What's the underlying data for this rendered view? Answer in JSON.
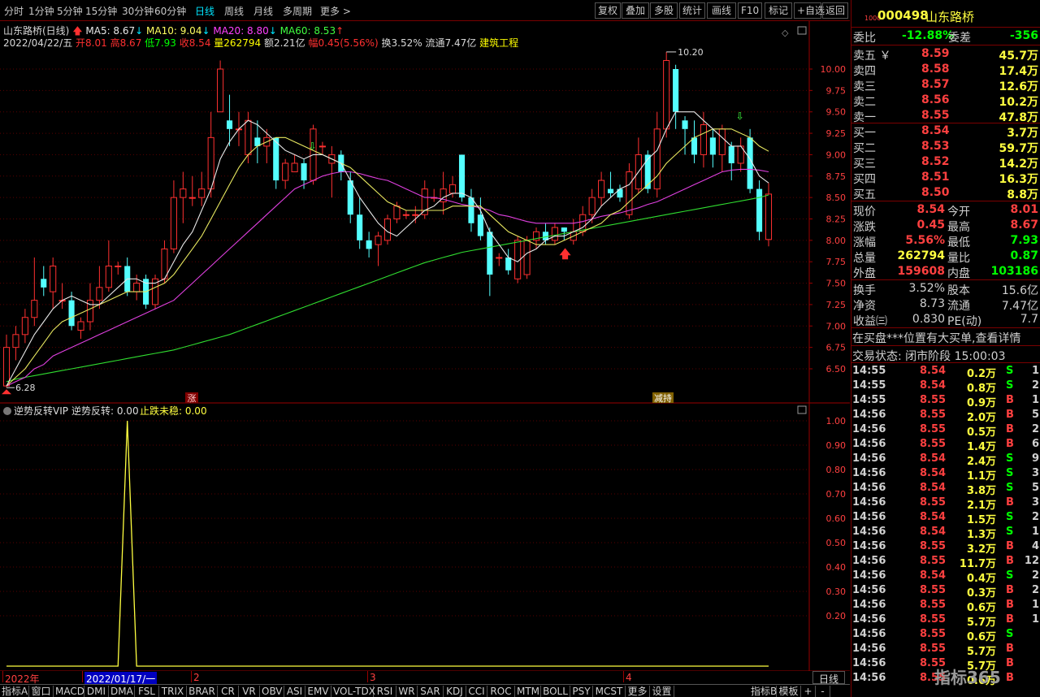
{
  "toolbar": {
    "periods": [
      "分时",
      "1分钟",
      "5分钟",
      "15分钟",
      "30分钟",
      "60分钟",
      "日线",
      "周线",
      "月线",
      "多周期",
      "更多 >"
    ],
    "active": "日线",
    "buttons": [
      "复权",
      "叠加",
      "多股",
      "统计",
      "画线",
      "F10",
      "标记",
      "+自选",
      "返回"
    ]
  },
  "info": {
    "name": "山东路桥(日线)",
    "ma5": "MA5: 8.67",
    "ma10": "MA10: 9.04",
    "ma20": "MA20: 8.80",
    "ma60": "MA60: 8.53",
    "date": "2022/04/22/五",
    "open": "开8.01",
    "high": "高8.67",
    "low": "低7.93",
    "close": "收8.54",
    "vol": "量262794",
    "amount": "额2.21亿",
    "amp": "幅0.45(5.56%)",
    "turnover": "换3.52%",
    "float": "流通7.47亿",
    "sector": "建筑工程"
  },
  "markers": {
    "high_label": "10.20",
    "low_label": "6.28",
    "zhang": "涨",
    "jianchi": "减持"
  },
  "indicator": {
    "name": "逆势反转VIP",
    "line1": "逆势反转: 0.00",
    "line2": "止跌未稳: 0.00",
    "ticks": [
      "1.00",
      "0.90",
      "0.80",
      "0.70",
      "0.60",
      "0.50",
      "0.40",
      "0.30",
      "0.20"
    ]
  },
  "chart_data": {
    "type": "candlestick",
    "price_ticks": [
      "10.00",
      "9.75",
      "9.50",
      "9.25",
      "9.00",
      "8.75",
      "8.50",
      "8.25",
      "8.00",
      "7.75",
      "7.50",
      "7.25",
      "7.00",
      "6.75",
      "6.50"
    ],
    "ylim": [
      6.28,
      10.2
    ],
    "date_labels": [
      "2022年",
      "2022/01/17/一",
      "2",
      "3",
      "4"
    ],
    "candles": [
      {
        "o": 6.3,
        "c": 6.75,
        "h": 6.9,
        "l": 6.28
      },
      {
        "o": 6.75,
        "c": 6.9,
        "h": 7.0,
        "l": 6.6
      },
      {
        "o": 6.9,
        "c": 7.1,
        "h": 7.2,
        "l": 6.8
      },
      {
        "o": 7.1,
        "c": 7.3,
        "h": 7.8,
        "l": 7.0
      },
      {
        "o": 7.55,
        "c": 7.45,
        "h": 7.7,
        "l": 7.35
      },
      {
        "o": 7.4,
        "c": 7.7,
        "h": 7.8,
        "l": 7.2
      },
      {
        "o": 7.3,
        "c": 7.3,
        "h": 7.5,
        "l": 7.2
      },
      {
        "o": 7.3,
        "c": 7.0,
        "h": 7.4,
        "l": 6.95
      },
      {
        "o": 6.95,
        "c": 7.05,
        "h": 7.1,
        "l": 6.85
      },
      {
        "o": 7.05,
        "c": 7.3,
        "h": 7.5,
        "l": 6.95
      },
      {
        "o": 7.3,
        "c": 7.45,
        "h": 7.7,
        "l": 7.2
      },
      {
        "o": 7.45,
        "c": 7.7,
        "h": 8.0,
        "l": 7.4
      },
      {
        "o": 7.7,
        "c": 7.7,
        "h": 7.75,
        "l": 7.6
      },
      {
        "o": 7.7,
        "c": 7.4,
        "h": 7.8,
        "l": 7.35
      },
      {
        "o": 7.4,
        "c": 7.5,
        "h": 7.6,
        "l": 7.3
      },
      {
        "o": 7.55,
        "c": 7.25,
        "h": 7.6,
        "l": 7.2
      },
      {
        "o": 7.25,
        "c": 7.55,
        "h": 7.6,
        "l": 7.2
      },
      {
        "o": 7.55,
        "c": 7.9,
        "h": 8.0,
        "l": 7.5
      },
      {
        "o": 7.9,
        "c": 8.5,
        "h": 8.7,
        "l": 7.85
      },
      {
        "o": 8.5,
        "c": 8.6,
        "h": 8.8,
        "l": 8.2
      },
      {
        "o": 8.5,
        "c": 8.5,
        "h": 8.75,
        "l": 8.4
      },
      {
        "o": 8.5,
        "c": 8.6,
        "h": 8.8,
        "l": 8.4
      },
      {
        "o": 8.6,
        "c": 9.2,
        "h": 9.5,
        "l": 8.5
      },
      {
        "o": 9.5,
        "c": 10.0,
        "h": 10.1,
        "l": 9.5
      },
      {
        "o": 9.4,
        "c": 9.3,
        "h": 9.7,
        "l": 9.1
      },
      {
        "o": 9.3,
        "c": 9.3,
        "h": 9.5,
        "l": 9.1
      },
      {
        "o": 9.0,
        "c": 9.4,
        "h": 9.5,
        "l": 8.9
      },
      {
        "o": 9.2,
        "c": 9.1,
        "h": 9.4,
        "l": 8.9
      },
      {
        "o": 9.1,
        "c": 9.2,
        "h": 9.3,
        "l": 8.9
      },
      {
        "o": 9.2,
        "c": 8.7,
        "h": 9.2,
        "l": 8.6
      },
      {
        "o": 8.7,
        "c": 8.9,
        "h": 8.95,
        "l": 8.6
      },
      {
        "o": 8.8,
        "c": 8.9,
        "h": 9.0,
        "l": 8.8
      },
      {
        "o": 8.9,
        "c": 8.7,
        "h": 8.95,
        "l": 8.6
      },
      {
        "o": 8.7,
        "c": 9.3,
        "h": 9.35,
        "l": 8.65
      },
      {
        "o": 9.1,
        "c": 9.1,
        "h": 9.15,
        "l": 9.0
      },
      {
        "o": 8.9,
        "c": 9.0,
        "h": 9.1,
        "l": 8.5
      },
      {
        "o": 9.0,
        "c": 8.8,
        "h": 9.05,
        "l": 8.7
      },
      {
        "o": 8.7,
        "c": 8.3,
        "h": 8.8,
        "l": 8.2
      },
      {
        "o": 8.3,
        "c": 8.0,
        "h": 8.5,
        "l": 7.9
      },
      {
        "o": 8.0,
        "c": 7.9,
        "h": 8.1,
        "l": 7.8
      },
      {
        "o": 7.95,
        "c": 8.05,
        "h": 8.1,
        "l": 7.7
      },
      {
        "o": 8.0,
        "c": 8.25,
        "h": 8.3,
        "l": 7.95
      },
      {
        "o": 8.25,
        "c": 8.4,
        "h": 8.45,
        "l": 8.2
      },
      {
        "o": 8.3,
        "c": 8.3,
        "h": 8.35,
        "l": 8.25
      },
      {
        "o": 8.3,
        "c": 8.3,
        "h": 8.4,
        "l": 8.2
      },
      {
        "o": 8.3,
        "c": 8.6,
        "h": 8.7,
        "l": 8.25
      },
      {
        "o": 8.5,
        "c": 8.5,
        "h": 8.6,
        "l": 8.45
      },
      {
        "o": 8.45,
        "c": 8.6,
        "h": 8.8,
        "l": 8.3
      },
      {
        "o": 8.55,
        "c": 8.65,
        "h": 8.75,
        "l": 8.5
      },
      {
        "o": 9.0,
        "c": 8.5,
        "h": 9.0,
        "l": 8.45
      },
      {
        "o": 8.5,
        "c": 8.2,
        "h": 8.6,
        "l": 8.1
      },
      {
        "o": 8.3,
        "c": 8.05,
        "h": 8.5,
        "l": 8.0
      },
      {
        "o": 8.1,
        "c": 7.6,
        "h": 8.15,
        "l": 7.35
      },
      {
        "o": 7.8,
        "c": 7.8,
        "h": 7.85,
        "l": 7.7
      },
      {
        "o": 7.8,
        "c": 7.65,
        "h": 7.9,
        "l": 7.6
      },
      {
        "o": 7.55,
        "c": 8.0,
        "h": 8.05,
        "l": 7.5
      },
      {
        "o": 7.6,
        "c": 8.0,
        "h": 8.05,
        "l": 7.55
      },
      {
        "o": 8.0,
        "c": 8.1,
        "h": 8.15,
        "l": 7.9
      },
      {
        "o": 8.1,
        "c": 8.0,
        "h": 8.2,
        "l": 7.95
      },
      {
        "o": 8.0,
        "c": 8.15,
        "h": 8.2,
        "l": 7.95
      },
      {
        "o": 8.15,
        "c": 8.1,
        "h": 8.15,
        "l": 8.0
      },
      {
        "o": 8.0,
        "c": 8.1,
        "h": 8.25,
        "l": 7.95
      },
      {
        "o": 8.1,
        "c": 8.3,
        "h": 8.4,
        "l": 8.05
      },
      {
        "o": 8.3,
        "c": 8.5,
        "h": 8.6,
        "l": 8.2
      },
      {
        "o": 8.5,
        "c": 8.7,
        "h": 8.8,
        "l": 8.4
      },
      {
        "o": 8.6,
        "c": 8.55,
        "h": 8.8,
        "l": 8.5
      },
      {
        "o": 8.6,
        "c": 8.5,
        "h": 8.65,
        "l": 8.45
      },
      {
        "o": 8.3,
        "c": 8.8,
        "h": 8.9,
        "l": 8.25
      },
      {
        "o": 8.6,
        "c": 9.0,
        "h": 9.2,
        "l": 8.55
      },
      {
        "o": 9.0,
        "c": 8.6,
        "h": 9.05,
        "l": 8.55
      },
      {
        "o": 8.6,
        "c": 9.3,
        "h": 9.5,
        "l": 8.5
      },
      {
        "o": 9.3,
        "c": 10.1,
        "h": 10.2,
        "l": 9.2
      },
      {
        "o": 10.0,
        "c": 9.5,
        "h": 10.05,
        "l": 9.3
      },
      {
        "o": 9.4,
        "c": 9.3,
        "h": 9.45,
        "l": 9.0
      },
      {
        "o": 9.2,
        "c": 9.0,
        "h": 9.4,
        "l": 8.9
      },
      {
        "o": 9.0,
        "c": 9.35,
        "h": 9.5,
        "l": 8.85
      },
      {
        "o": 9.2,
        "c": 9.0,
        "h": 9.3,
        "l": 8.85
      },
      {
        "o": 9.0,
        "c": 9.3,
        "h": 9.35,
        "l": 8.8
      },
      {
        "o": 9.1,
        "c": 8.9,
        "h": 9.15,
        "l": 8.7
      },
      {
        "o": 8.9,
        "c": 9.1,
        "h": 9.2,
        "l": 8.8
      },
      {
        "o": 9.2,
        "c": 8.6,
        "h": 9.3,
        "l": 8.55
      },
      {
        "o": 8.6,
        "c": 8.1,
        "h": 8.7,
        "l": 8.0
      },
      {
        "o": 8.01,
        "c": 8.54,
        "h": 8.67,
        "l": 7.93
      }
    ],
    "ma5": [
      6.3,
      6.5,
      6.7,
      6.9,
      7.05,
      7.2,
      7.3,
      7.35,
      7.3,
      7.25,
      7.25,
      7.35,
      7.45,
      7.55,
      7.55,
      7.5,
      7.5,
      7.55,
      7.75,
      7.95,
      8.1,
      8.35,
      8.6,
      8.95,
      9.15,
      9.3,
      9.4,
      9.35,
      9.25,
      9.15,
      9.05,
      9.0,
      8.95,
      9.0,
      9.0,
      8.95,
      8.9,
      8.7,
      8.5,
      8.35,
      8.2,
      8.1,
      8.05,
      8.15,
      8.25,
      8.35,
      8.4,
      8.5,
      8.55,
      8.55,
      8.5,
      8.35,
      8.1,
      7.95,
      7.8,
      7.75,
      7.85,
      7.9,
      8.0,
      8.05,
      8.05,
      8.1,
      8.15,
      8.25,
      8.4,
      8.5,
      8.6,
      8.65,
      8.8,
      8.95,
      9.05,
      9.3,
      9.5,
      9.5,
      9.5,
      9.4,
      9.3,
      9.2,
      9.1,
      9.1,
      8.95,
      8.75,
      8.67
    ],
    "ma10": [
      6.3,
      6.4,
      6.5,
      6.65,
      6.8,
      6.95,
      7.05,
      7.1,
      7.15,
      7.2,
      7.25,
      7.3,
      7.35,
      7.4,
      7.4,
      7.4,
      7.45,
      7.5,
      7.6,
      7.75,
      7.9,
      8.05,
      8.25,
      8.45,
      8.65,
      8.85,
      9.0,
      9.1,
      9.15,
      9.2,
      9.2,
      9.15,
      9.1,
      9.05,
      9.0,
      8.95,
      8.9,
      8.85,
      8.75,
      8.65,
      8.55,
      8.45,
      8.4,
      8.35,
      8.35,
      8.35,
      8.35,
      8.35,
      8.4,
      8.4,
      8.4,
      8.4,
      8.3,
      8.2,
      8.1,
      8.05,
      8.0,
      7.95,
      7.95,
      7.95,
      8.0,
      8.05,
      8.1,
      8.15,
      8.2,
      8.3,
      8.35,
      8.45,
      8.55,
      8.65,
      8.75,
      8.9,
      9.0,
      9.1,
      9.2,
      9.25,
      9.3,
      9.3,
      9.3,
      9.25,
      9.2,
      9.1,
      9.04
    ],
    "ma20": [
      6.3,
      6.35,
      6.4,
      6.5,
      6.55,
      6.65,
      6.7,
      6.75,
      6.8,
      6.85,
      6.9,
      6.95,
      7.0,
      7.05,
      7.1,
      7.15,
      7.2,
      7.25,
      7.3,
      7.4,
      7.5,
      7.6,
      7.7,
      7.8,
      7.9,
      8.0,
      8.1,
      8.2,
      8.3,
      8.4,
      8.5,
      8.6,
      8.65,
      8.7,
      8.75,
      8.78,
      8.8,
      8.8,
      8.78,
      8.75,
      8.72,
      8.7,
      8.65,
      8.6,
      8.55,
      8.5,
      8.5,
      8.48,
      8.45,
      8.42,
      8.4,
      8.38,
      8.35,
      8.3,
      8.28,
      8.25,
      8.22,
      8.2,
      8.2,
      8.2,
      8.2,
      8.2,
      8.22,
      8.25,
      8.28,
      8.3,
      8.32,
      8.35,
      8.38,
      8.42,
      8.45,
      8.5,
      8.55,
      8.6,
      8.65,
      8.7,
      8.75,
      8.8,
      8.82,
      8.83,
      8.83,
      8.82,
      8.8
    ],
    "ma60": [
      6.35,
      6.38,
      6.4,
      6.42,
      6.44,
      6.46,
      6.48,
      6.5,
      6.52,
      6.54,
      6.56,
      6.58,
      6.6,
      6.62,
      6.64,
      6.66,
      6.68,
      6.7,
      6.72,
      6.75,
      6.78,
      6.81,
      6.84,
      6.87,
      6.9,
      6.94,
      6.98,
      7.02,
      7.06,
      7.1,
      7.14,
      7.18,
      7.22,
      7.26,
      7.3,
      7.34,
      7.38,
      7.42,
      7.46,
      7.5,
      7.54,
      7.58,
      7.62,
      7.66,
      7.7,
      7.74,
      7.77,
      7.8,
      7.83,
      7.86,
      7.88,
      7.9,
      7.92,
      7.94,
      7.96,
      7.98,
      8.0,
      8.02,
      8.04,
      8.06,
      8.08,
      8.1,
      8.12,
      8.14,
      8.16,
      8.18,
      8.2,
      8.22,
      8.24,
      8.26,
      8.28,
      8.3,
      8.32,
      8.34,
      8.36,
      8.38,
      8.4,
      8.42,
      8.44,
      8.46,
      8.48,
      8.5,
      8.53
    ],
    "indicator_spike_index": 13
  },
  "quote": {
    "code": "000498",
    "name": "山东路桥",
    "weibi_label": "委比",
    "weibi": "-12.88%",
    "weicha_label": "委差",
    "weicha": "-356",
    "sells": [
      {
        "label": "卖五 ￥",
        "price": "8.59",
        "vol": "45.7万"
      },
      {
        "label": "卖四",
        "price": "8.58",
        "vol": "17.4万"
      },
      {
        "label": "卖三",
        "price": "8.57",
        "vol": "12.6万"
      },
      {
        "label": "卖二",
        "price": "8.56",
        "vol": "10.2万"
      },
      {
        "label": "卖一",
        "price": "8.55",
        "vol": "47.8万"
      }
    ],
    "buys": [
      {
        "label": "买一",
        "price": "8.54",
        "vol": "3.7万"
      },
      {
        "label": "买二",
        "price": "8.53",
        "vol": "59.7万"
      },
      {
        "label": "买三",
        "price": "8.52",
        "vol": "14.2万"
      },
      {
        "label": "买四",
        "price": "8.51",
        "vol": "16.3万"
      },
      {
        "label": "买五",
        "price": "8.50",
        "vol": "8.8万"
      }
    ],
    "stats": [
      {
        "l1": "现价",
        "v1": "8.54",
        "c1": "red",
        "l2": "今开",
        "v2": "8.01",
        "c2": "red"
      },
      {
        "l1": "涨跌",
        "v1": "0.45",
        "c1": "red",
        "l2": "最高",
        "v2": "8.67",
        "c2": "red"
      },
      {
        "l1": "涨幅",
        "v1": "5.56%",
        "c1": "red",
        "l2": "最低",
        "v2": "7.93",
        "c2": "green"
      },
      {
        "l1": "总量",
        "v1": "262794",
        "c1": "yellow",
        "l2": "量比",
        "v2": "0.87",
        "c2": "green"
      },
      {
        "l1": "外盘",
        "v1": "159608",
        "c1": "red",
        "l2": "内盘",
        "v2": "103186",
        "c2": "green"
      }
    ],
    "stats2": [
      {
        "l1": "换手",
        "v1": "3.52%",
        "l2": "股本",
        "v2": "15.6亿"
      },
      {
        "l1": "净资",
        "v1": "8.73",
        "l2": "流通",
        "v2": "7.47亿"
      },
      {
        "l1": "收益㈢",
        "v1": "0.830",
        "l2": "PE(动)",
        "v2": "7.7"
      }
    ],
    "notice": "在买盘***位置有大买单,查看详情",
    "status": "交易状态: 闭市阶段 15:00:03",
    "trades": [
      {
        "t": "14:55",
        "p": "8.54",
        "pc": "red",
        "v": "0.2万",
        "s": "S",
        "n": "1"
      },
      {
        "t": "14:55",
        "p": "8.54",
        "pc": "red",
        "v": "0.8万",
        "s": "S",
        "n": "2"
      },
      {
        "t": "14:55",
        "p": "8.55",
        "pc": "red",
        "v": "0.9万",
        "s": "B",
        "n": "1"
      },
      {
        "t": "14:56",
        "p": "8.55",
        "pc": "red",
        "v": "2.0万",
        "s": "B",
        "n": "5"
      },
      {
        "t": "14:56",
        "p": "8.55",
        "pc": "red",
        "v": "0.5万",
        "s": "B",
        "n": "2"
      },
      {
        "t": "14:56",
        "p": "8.55",
        "pc": "red",
        "v": "1.4万",
        "s": "B",
        "n": "6"
      },
      {
        "t": "14:56",
        "p": "8.54",
        "pc": "red",
        "v": "2.4万",
        "s": "S",
        "n": "9"
      },
      {
        "t": "14:56",
        "p": "8.54",
        "pc": "red",
        "v": "1.1万",
        "s": "S",
        "n": "3"
      },
      {
        "t": "14:56",
        "p": "8.54",
        "pc": "red",
        "v": "3.8万",
        "s": "S",
        "n": "5"
      },
      {
        "t": "14:56",
        "p": "8.55",
        "pc": "red",
        "v": "2.1万",
        "s": "B",
        "n": "3"
      },
      {
        "t": "14:56",
        "p": "8.54",
        "pc": "red",
        "v": "1.5万",
        "s": "S",
        "n": "2"
      },
      {
        "t": "14:56",
        "p": "8.54",
        "pc": "red",
        "v": "1.3万",
        "s": "S",
        "n": "1"
      },
      {
        "t": "14:56",
        "p": "8.55",
        "pc": "red",
        "v": "3.2万",
        "s": "B",
        "n": "4"
      },
      {
        "t": "14:56",
        "p": "8.55",
        "pc": "red",
        "v": "11.7万",
        "s": "B",
        "n": "12"
      },
      {
        "t": "14:56",
        "p": "8.54",
        "pc": "red",
        "v": "0.4万",
        "s": "S",
        "n": "2"
      },
      {
        "t": "14:56",
        "p": "8.55",
        "pc": "red",
        "v": "0.3万",
        "s": "B",
        "n": "2"
      },
      {
        "t": "14:56",
        "p": "8.55",
        "pc": "red",
        "v": "0.6万",
        "s": "B",
        "n": "1"
      },
      {
        "t": "14:56",
        "p": "8.55",
        "pc": "red",
        "v": "5.7万",
        "s": "B",
        "n": "1"
      },
      {
        "t": "14:56",
        "p": "8.55",
        "pc": "red",
        "v": "0.6万",
        "s": "S",
        "n": ""
      },
      {
        "t": "14:56",
        "p": "8.55",
        "pc": "red",
        "v": "5.7万",
        "s": "B",
        "n": ""
      },
      {
        "t": "14:56",
        "p": "8.55",
        "pc": "red",
        "v": "5.7万",
        "s": "B",
        "n": ""
      },
      {
        "t": "14:56",
        "p": "8.55",
        "pc": "red",
        "v": "0.6万",
        "s": "B",
        "n": ""
      }
    ]
  },
  "tabs": [
    "指标A",
    "窗口",
    "MACD",
    "DMI",
    "DMA",
    "FSL",
    "TRIX",
    "BRAR",
    "CR",
    "VR",
    "OBV",
    "ASI",
    "EMV",
    "VOL-TDX",
    "RSI",
    "WR",
    "SAR",
    "KDJ",
    "CCI",
    "ROC",
    "MTM",
    "BOLL",
    "PSY",
    "MCST",
    "更多",
    "设置",
    "指标B",
    "模板",
    "+",
    "-"
  ],
  "period_label": "日线",
  "watermark": "指标365"
}
